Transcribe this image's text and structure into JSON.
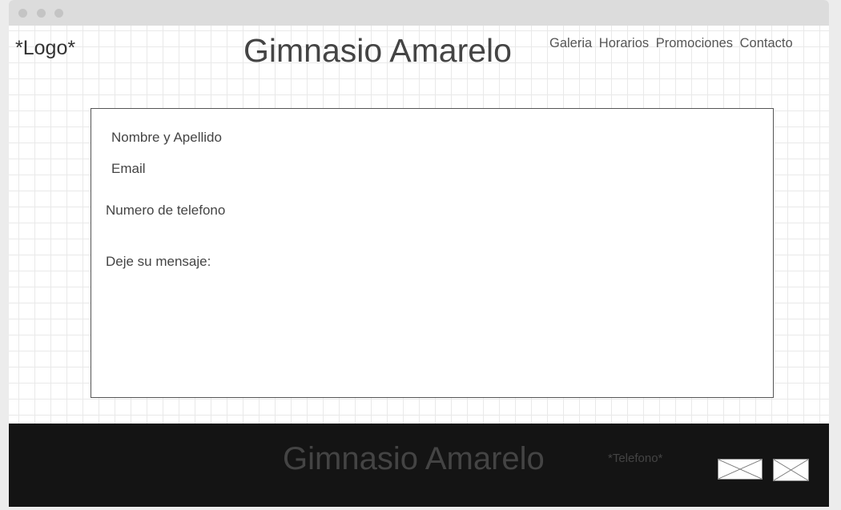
{
  "header": {
    "logo": "*Logo*",
    "title": "Gimnasio Amarelo",
    "nav": [
      "Galeria",
      "Horarios",
      "Promociones",
      "Contacto"
    ]
  },
  "form": {
    "name_label": "Nombre y Apellido",
    "email_label": "Email",
    "phone_label": "Numero de telefono",
    "message_label": "Deje su mensaje:"
  },
  "footer": {
    "title": "Gimnasio Amarelo",
    "phone": "*Telefono*",
    "icons": [
      "image-placeholder-icon",
      "image-placeholder-icon"
    ]
  }
}
